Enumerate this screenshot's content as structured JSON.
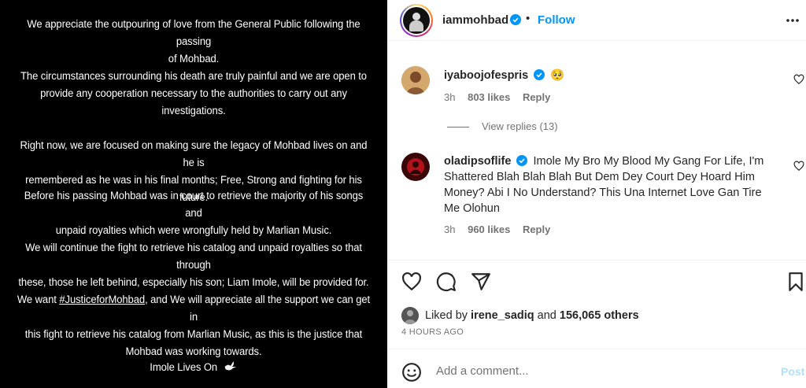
{
  "post_image": {
    "paragraphs": [
      [
        "We appreciate the outpouring of love from the General Public following the passing",
        "of Mohbad."
      ],
      [
        "The circumstances surrounding his death are truly painful and we are open to",
        "provide any cooperation necessary to the authorities to carry out any",
        "investigations."
      ],
      [
        "Right now, we are focused on making sure the legacy of Mohbad lives on and he is",
        "remembered as he was in his final months; Free, Strong and fighting for his future."
      ],
      [
        "Before his passing Mohbad was in court to retrieve the majority of his songs and",
        "unpaid royalties which were wrongfully held by Marlian Music."
      ],
      [
        "We will continue the fight to retrieve his catalog and unpaid royalties so that through",
        "these, those he left behind, especially his son; Liam Imole, will be provided for."
      ]
    ],
    "justice_line_prefix": "We want ",
    "hashtag": "#JusticeforMohbad",
    "justice_line_suffix": ", and We will appreciate all the support we can get in",
    "justice_lines_rest": [
      "this fight to retrieve his catalog from Marlian Music, as this is the justice that",
      "Mohbad was working towards."
    ],
    "closing": "Imole Lives On"
  },
  "header": {
    "username": "iammohbad",
    "separator": "•",
    "follow_label": "Follow",
    "more_icon": "more-horizontal-icon"
  },
  "comments": [
    {
      "username": "iyaboojofespris",
      "text": "🥺",
      "time": "3h",
      "likes": "803 likes",
      "reply_label": "Reply",
      "view_replies": "View replies (13)"
    },
    {
      "username": "oladipsoflife",
      "text": "Imole My Bro My Blood My Gang For Life, I'm Shattered Blah Blah Blah But Dem Dey Court Dey Hoard Him Money? Abi I No Understand? This Una Internet Love Gan Tire Me Olohun",
      "time": "3h",
      "likes": "960 likes",
      "reply_label": "Reply"
    }
  ],
  "likes": {
    "prefix": "Liked by ",
    "user": "irene_sadiq",
    "mid": " and ",
    "count": "156,065 others"
  },
  "timestamp": "4 HOURS AGO",
  "add_comment": {
    "placeholder": "Add a comment...",
    "post_label": "Post"
  },
  "colors": {
    "accent": "#0095f6",
    "verified": "#0095f6",
    "post_disabled": "#b2dffc",
    "muted": "#737373"
  }
}
